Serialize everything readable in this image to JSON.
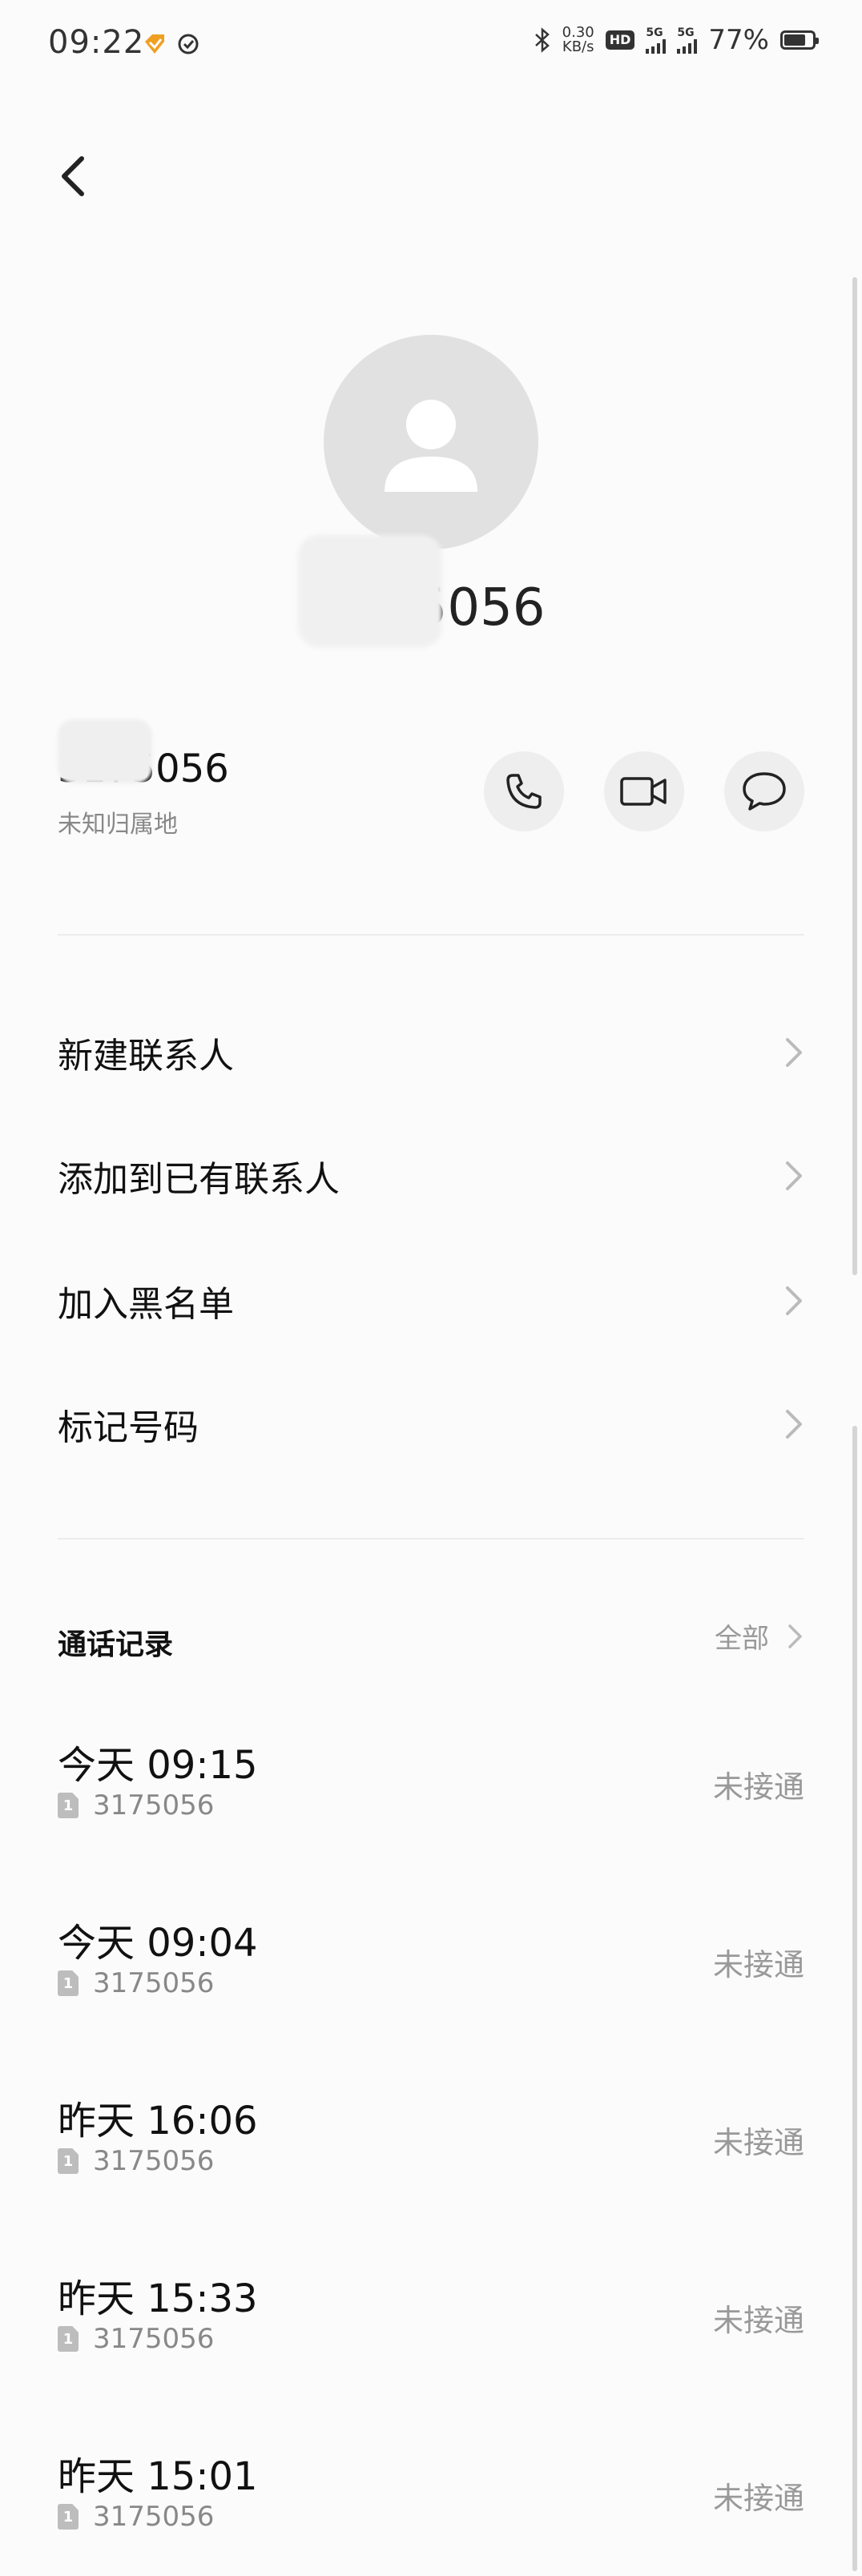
{
  "status_bar": {
    "time": "09:22",
    "network_speed_value": "0.30",
    "network_speed_unit": "KB/s",
    "hd_label": "HD",
    "sim1_tech": "5G",
    "sim2_tech": "5G",
    "battery_percent": "77%",
    "battery_level": 0.77
  },
  "header": {
    "title_number": "3175056"
  },
  "number_row": {
    "number": "3175056",
    "location": "未知归属地"
  },
  "menu": [
    {
      "label": "新建联系人"
    },
    {
      "label": "添加到已有联系人"
    },
    {
      "label": "加入黑名单"
    },
    {
      "label": "标记号码"
    }
  ],
  "call_log": {
    "title": "通话记录",
    "all_label": "全部",
    "entries": [
      {
        "time": "今天 09:15",
        "sim": "1",
        "number": "3175056",
        "status": "未接通"
      },
      {
        "time": "今天 09:04",
        "sim": "1",
        "number": "3175056",
        "status": "未接通"
      },
      {
        "time": "昨天 16:06",
        "sim": "1",
        "number": "3175056",
        "status": "未接通"
      },
      {
        "time": "昨天 15:33",
        "sim": "1",
        "number": "3175056",
        "status": "未接通"
      },
      {
        "time": "昨天 15:01",
        "sim": "1",
        "number": "3175056",
        "status": "未接通"
      }
    ]
  },
  "colors": {
    "background": "#fbfbfb",
    "avatar_bg": "#e1e1e1",
    "action_bg": "#eeeeee",
    "secondary_text": "#999999",
    "notification_orange": "#f0a020"
  }
}
